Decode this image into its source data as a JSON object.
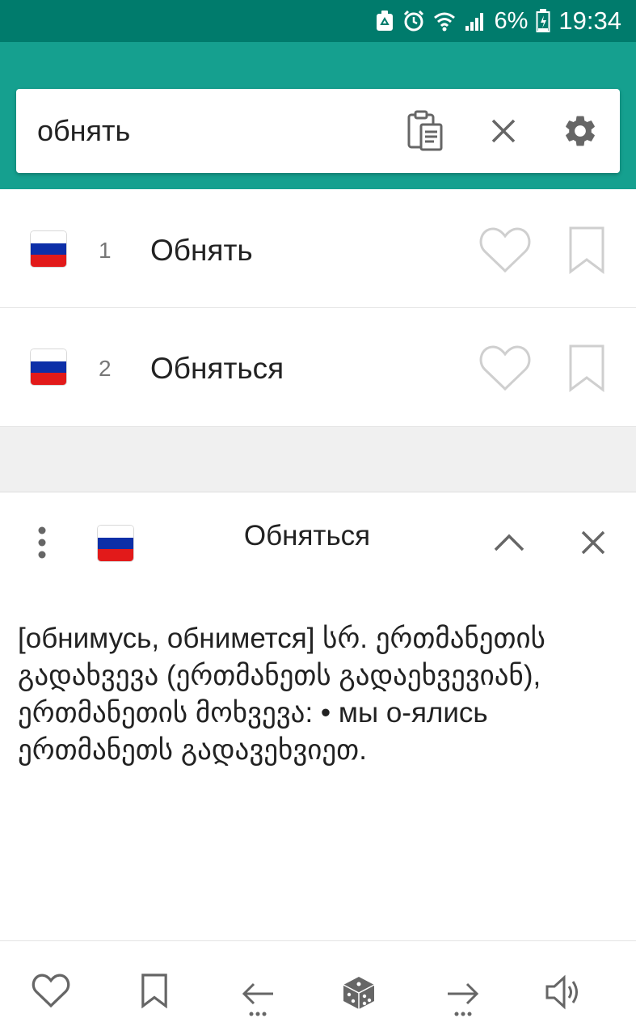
{
  "status_bar": {
    "battery_text": "6%",
    "time": "19:34",
    "icons": [
      "recycle-notification-icon",
      "alarm-icon",
      "wifi-icon",
      "signal-icon",
      "battery-icon"
    ]
  },
  "search": {
    "value": "обнять",
    "placeholder": "",
    "icons": [
      "clipboard-icon",
      "clear-icon",
      "settings-icon"
    ]
  },
  "results": [
    {
      "number": "1",
      "word": "Обнять",
      "flag": "russia-flag-icon"
    },
    {
      "number": "2",
      "word": "Обняться",
      "flag": "russia-flag-icon"
    }
  ],
  "detail": {
    "title": "Обняться",
    "body": "[обнимусь, обнимется] სრ. ერთმანეთის გადახვევა (ერთმანეთს გადაეხვევიან), ერთმანეთის მოხვევა: • мы о-ялись ერთმანეთს გადავეხვიეთ.",
    "icons": [
      "more-vert-icon",
      "russia-flag-icon",
      "chevron-up-icon",
      "close-icon"
    ]
  },
  "bottom_bar": {
    "icons": [
      "favorite-icon",
      "bookmark-icon",
      "back-arrow-icon",
      "random-dice-icon",
      "forward-arrow-icon",
      "speaker-icon"
    ]
  },
  "colors": {
    "status_bar": "#007b6c",
    "app_bar": "#15a08f",
    "icon_gray": "#666666",
    "light_icon_gray": "#cfcfcf"
  }
}
